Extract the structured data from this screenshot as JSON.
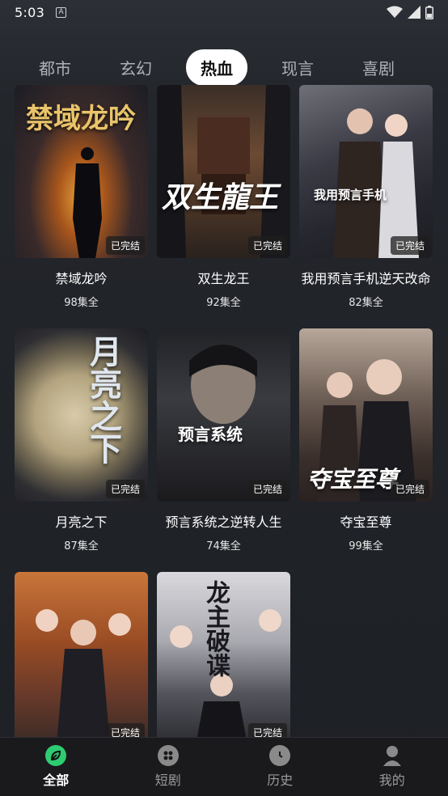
{
  "status_bar": {
    "time": "5:03",
    "notif_letter": "A"
  },
  "tabs": [
    {
      "label": "都市"
    },
    {
      "label": "玄幻"
    },
    {
      "label": "热血"
    },
    {
      "label": "现言"
    },
    {
      "label": "喜剧"
    }
  ],
  "dramas": [
    {
      "title": "禁域龙吟",
      "episodes": "98集全",
      "badge": "已完结",
      "cover_text": "禁域龙吟"
    },
    {
      "title": "双生龙王",
      "episodes": "92集全",
      "badge": "已完结",
      "cover_text": "双生龍王"
    },
    {
      "title": "我用预言手机逆天改命",
      "episodes": "82集全",
      "badge": "已完结",
      "cover_text": "我用预言手机"
    },
    {
      "title": "月亮之下",
      "episodes": "87集全",
      "badge": "已完结",
      "cover_text": "月亮之下"
    },
    {
      "title": "预言系统之逆转人生",
      "episodes": "74集全",
      "badge": "已完结",
      "cover_text": "预言系统"
    },
    {
      "title": "夺宝至尊",
      "episodes": "99集全",
      "badge": "已完结",
      "cover_text": "夺宝至尊"
    },
    {
      "title": "",
      "episodes": "",
      "badge": "已完结",
      "cover_text": ""
    },
    {
      "title": "",
      "episodes": "",
      "badge": "已完结",
      "cover_text": "龙主破谍"
    }
  ],
  "bottom_nav": [
    {
      "label": "全部",
      "icon": "leaf-icon"
    },
    {
      "label": "短剧",
      "icon": "film-reel-icon"
    },
    {
      "label": "历史",
      "icon": "clock-icon"
    },
    {
      "label": "我的",
      "icon": "user-icon"
    }
  ],
  "colors": {
    "accent": "#2ecc71",
    "background": "#1d2025",
    "active_tab_bg": "#ffffff"
  }
}
